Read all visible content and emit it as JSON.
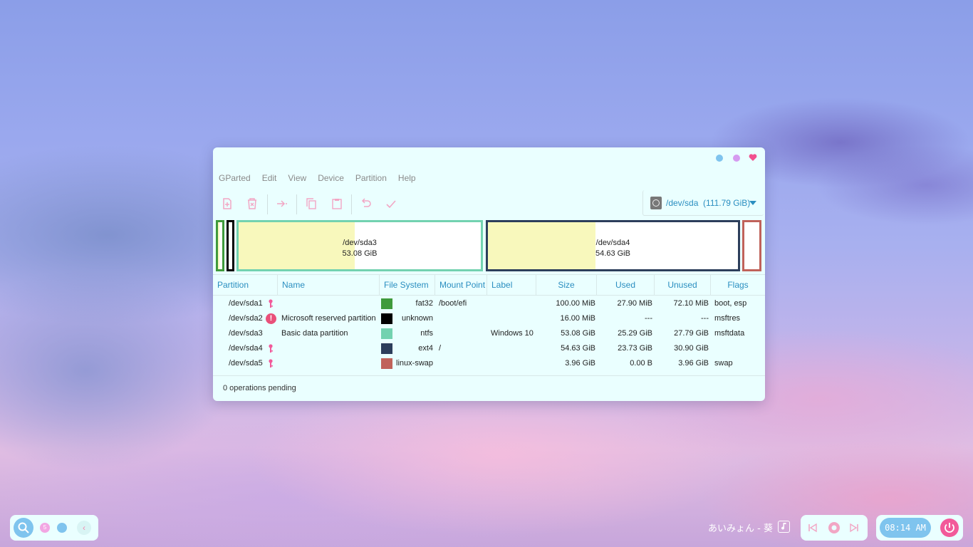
{
  "menubar": [
    "GParted",
    "Edit",
    "View",
    "Device",
    "Partition",
    "Help"
  ],
  "device": {
    "name": "/dev/sda",
    "size": "(111.79 GiB)"
  },
  "partition_map": [
    {
      "name": "",
      "size": "",
      "color": "#3f9a3c",
      "used_fraction": 0.28
    },
    {
      "name": "",
      "size": "",
      "color": "#000000",
      "used_fraction": 0
    },
    {
      "name": "/dev/sda3",
      "size": "53.08 GiB",
      "color": "#73d2b0",
      "used_fraction": 0.48
    },
    {
      "name": "/dev/sda4",
      "size": "54.63 GiB",
      "color": "#2c3e5b",
      "used_fraction": 0.43
    },
    {
      "name": "",
      "size": "",
      "color": "#c0625a",
      "used_fraction": 0
    }
  ],
  "columns": [
    "Partition",
    "Name",
    "File System",
    "Mount Point",
    "Label",
    "Size",
    "Used",
    "Unused",
    "Flags"
  ],
  "rows": [
    {
      "partition": "/dev/sda1",
      "name": "",
      "fs": "fat32",
      "fs_color": "#3f9a3c",
      "mount": "/boot/efi",
      "label": "",
      "size": "100.00 MiB",
      "used": "27.90 MiB",
      "unused": "72.10 MiB",
      "flags": "boot, esp",
      "icon": "key"
    },
    {
      "partition": "/dev/sda2",
      "name": "Microsoft reserved partition",
      "fs": "unknown",
      "fs_color": "#000000",
      "mount": "",
      "label": "",
      "size": "16.00 MiB",
      "used": "---",
      "unused": "---",
      "flags": "msftres",
      "icon": "warning"
    },
    {
      "partition": "/dev/sda3",
      "name": "Basic data partition",
      "fs": "ntfs",
      "fs_color": "#73d2b0",
      "mount": "",
      "label": "Windows 10",
      "size": "53.08 GiB",
      "used": "25.29 GiB",
      "unused": "27.79 GiB",
      "flags": "msftdata",
      "icon": ""
    },
    {
      "partition": "/dev/sda4",
      "name": "",
      "fs": "ext4",
      "fs_color": "#2c3e5b",
      "mount": "/",
      "label": "",
      "size": "54.63 GiB",
      "used": "23.73 GiB",
      "unused": "30.90 GiB",
      "flags": "",
      "icon": "key"
    },
    {
      "partition": "/dev/sda5",
      "name": "",
      "fs": "linux-swap",
      "fs_color": "#c0625a",
      "mount": "",
      "label": "",
      "size": "3.96 GiB",
      "used": "0.00 B",
      "unused": "3.96 GiB",
      "flags": "swap",
      "icon": "key"
    }
  ],
  "status": "0 operations pending",
  "dock": {
    "workspace_badge": "5",
    "collapse_glyph": "‹"
  },
  "music": {
    "track": "あいみょん - 葵"
  },
  "clock": {
    "time": "08:14 AM"
  }
}
